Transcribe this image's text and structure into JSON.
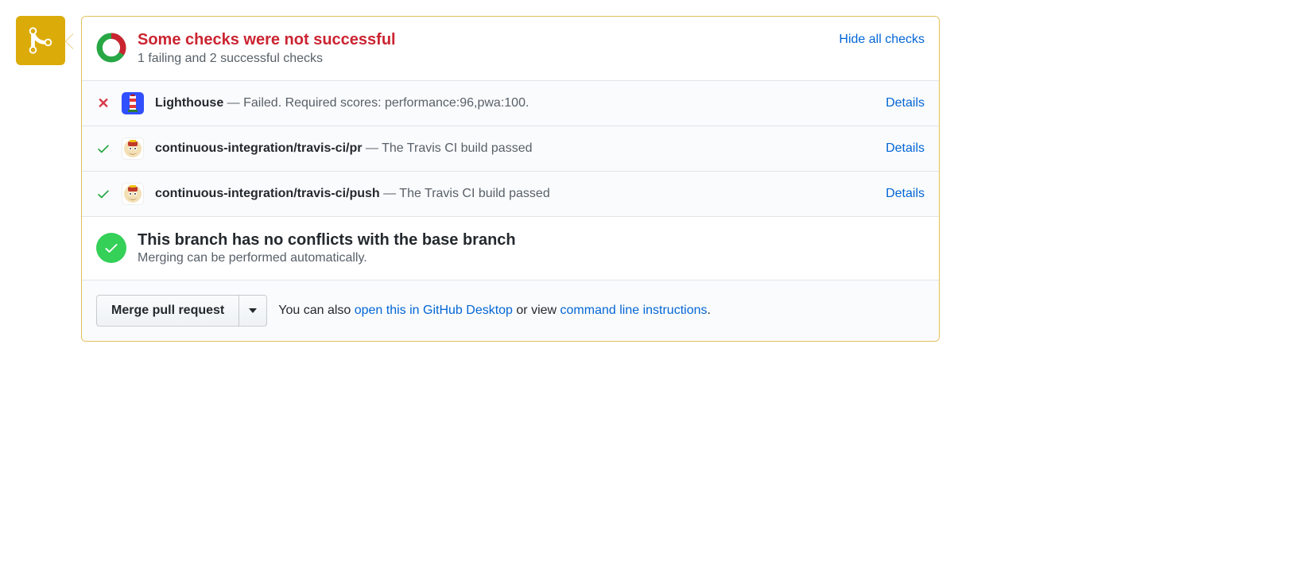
{
  "header": {
    "title": "Some checks were not successful",
    "subtitle": "1 failing and 2 successful checks",
    "hide_link": "Hide all checks"
  },
  "checks": [
    {
      "status": "fail",
      "avatar": "lighthouse",
      "name": "Lighthouse",
      "sep": " — ",
      "desc": "Failed. Required scores: performance:96,pwa:100.",
      "details": "Details"
    },
    {
      "status": "pass",
      "avatar": "travis",
      "name": "continuous-integration/travis-ci/pr",
      "sep": " — ",
      "desc": "The Travis CI build passed",
      "details": "Details"
    },
    {
      "status": "pass",
      "avatar": "travis",
      "name": "continuous-integration/travis-ci/push",
      "sep": " — ",
      "desc": "The Travis CI build passed",
      "details": "Details"
    }
  ],
  "conflicts": {
    "title": "This branch has no conflicts with the base branch",
    "subtitle": "Merging can be performed automatically."
  },
  "footer": {
    "merge_button": "Merge pull request",
    "prefix": "You can also ",
    "link1": "open this in GitHub Desktop",
    "mid": " or view ",
    "link2": "command line instructions",
    "suffix": "."
  }
}
